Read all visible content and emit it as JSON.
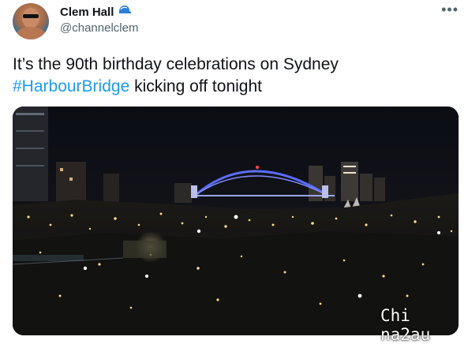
{
  "author": {
    "display_name": "Clem Hall",
    "handle": "@channelclem",
    "badge_icon": "blue-cap-icon"
  },
  "more_menu": {
    "glyph": "•••"
  },
  "tweet": {
    "text_before": "It’s the 90th birthday celebrations on Sydney",
    "hashtag": "#HarbourBridge",
    "text_after": " kicking off tonight"
  },
  "media": {
    "type": "video",
    "subject": "night view of Sydney Harbour Bridge"
  },
  "watermark": {
    "text": "Chi na2au"
  },
  "colors": {
    "accent": "#1d9bf0",
    "text": "#0f1419",
    "secondary": "#536471",
    "bridge": "#5b6cff"
  }
}
